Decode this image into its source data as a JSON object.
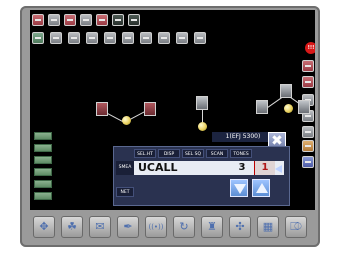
{
  "network_label": "1(EFJ 5300)",
  "close_glyph": "✖",
  "panel": {
    "tabs": [
      "SEL.HT",
      "DISP",
      "SEL SQ",
      "SCAN",
      "TONES"
    ],
    "row_label": "SMEA",
    "channel_name": "UCALL",
    "value_1": "3",
    "value_2": "1",
    "net_button": "NET"
  },
  "alert": "!!!",
  "icons": {
    "close": "close-icon",
    "left_arrow": "triangle-left-icon",
    "down_arrow": "triangle-down-icon",
    "up_arrow": "triangle-up-icon"
  },
  "bottom_bar": [
    "✥",
    "☘",
    "✉",
    "✒",
    "((•))",
    "↻",
    "♜",
    "✣",
    "▦",
    "⎄"
  ],
  "colors": {
    "accent": "#d81818",
    "panel": "#2a3250",
    "screen": "#000000"
  }
}
